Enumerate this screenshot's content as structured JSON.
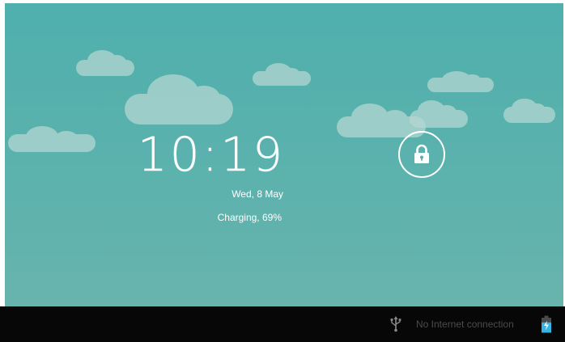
{
  "lockscreen": {
    "time": "10:19",
    "date": "Wed, 8 May",
    "charging_status": "Charging, 69%",
    "lock_icon": "padlock-icon"
  },
  "status_bar": {
    "usb_icon": "usb-icon",
    "network_status": "No Internet connection",
    "battery_icon": "battery-charging-icon",
    "battery_level_percent": 69
  },
  "colors": {
    "wallpaper": "#56b0ad",
    "cloud": "#b7d8d3",
    "text": "#ffffff",
    "navbar": "#070707",
    "navbar_text": "#4c4c4c",
    "battery_accent": "#33b5e5"
  }
}
